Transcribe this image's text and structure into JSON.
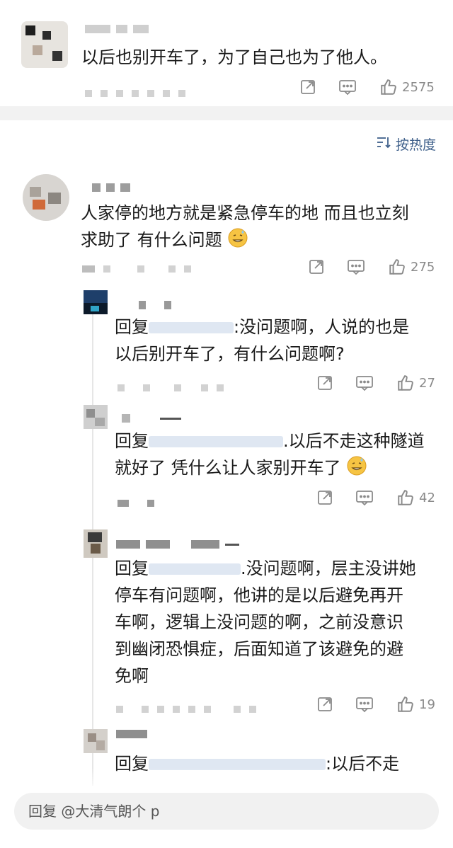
{
  "top_comment": {
    "text": "以后也别开车了，为了自己也为了他人。",
    "likes": "2575"
  },
  "sort": {
    "label": "按热度",
    "icon": "sort-icon"
  },
  "comment": {
    "text_line1": "人家停的地方就是紧急停车的地 而且也立刻",
    "text_line2": "求助了 有什么问题",
    "emoji": "sweat-smile-emoji",
    "likes": "275"
  },
  "replies": [
    {
      "prefix": "回复",
      "line1_suffix": ":没问题啊，人说的也是",
      "line2": "以后别开车了，有什么问题啊?",
      "likes": "27"
    },
    {
      "prefix": "回复",
      "line1_suffix": ".以后不走这种隧道",
      "line2": "就好了 凭什么让人家别开车了",
      "emoji": "sweat-smile-emoji",
      "likes": "42"
    },
    {
      "prefix": "回复",
      "line1_suffix": ".没问题啊，层主没讲她",
      "line2": "停车有问题啊，他讲的是以后避免再开",
      "line3": "车啊，逻辑上没问题的啊，之前没意识",
      "line4": "到幽闭恐惧症，后面知道了该避免的避",
      "line5": "免啊",
      "likes": "19"
    },
    {
      "prefix": "回复",
      "line1_suffix": ":以后不走"
    }
  ],
  "reply_input": {
    "placeholder": "回复 @大清气朗个 p"
  },
  "colors": {
    "link": "#3e5f8a",
    "gray": "#8a8a8a",
    "band": "#f2f2f2"
  }
}
